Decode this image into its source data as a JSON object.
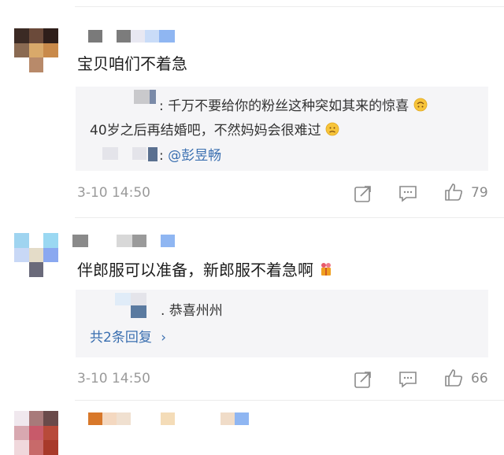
{
  "comments": [
    {
      "text": "宝贝咱们不着急",
      "quote_lines": [
        ": 千万不要给你的粉丝这种突如其来的惊喜",
        "40岁之后再结婚吧，不然妈妈会很难过"
      ],
      "quote_mention_prefix": ":",
      "quote_mention": "@彭昱畅",
      "time": "3-10 14:50",
      "likes": "79"
    },
    {
      "text": "伴郎服可以准备，新郎服不着急啊",
      "reply_preview": ". 恭喜州州",
      "more_replies": "共2条回复",
      "more_arrow": "›",
      "time": "3-10 14:50",
      "likes": "66"
    }
  ],
  "icons": {
    "share": "share-icon",
    "comment": "comment-icon",
    "like": "thumbs-up-icon"
  },
  "colors": {
    "link": "#3a6fb0",
    "meta": "#9a9a9a",
    "quote_bg": "#f5f5f7"
  }
}
